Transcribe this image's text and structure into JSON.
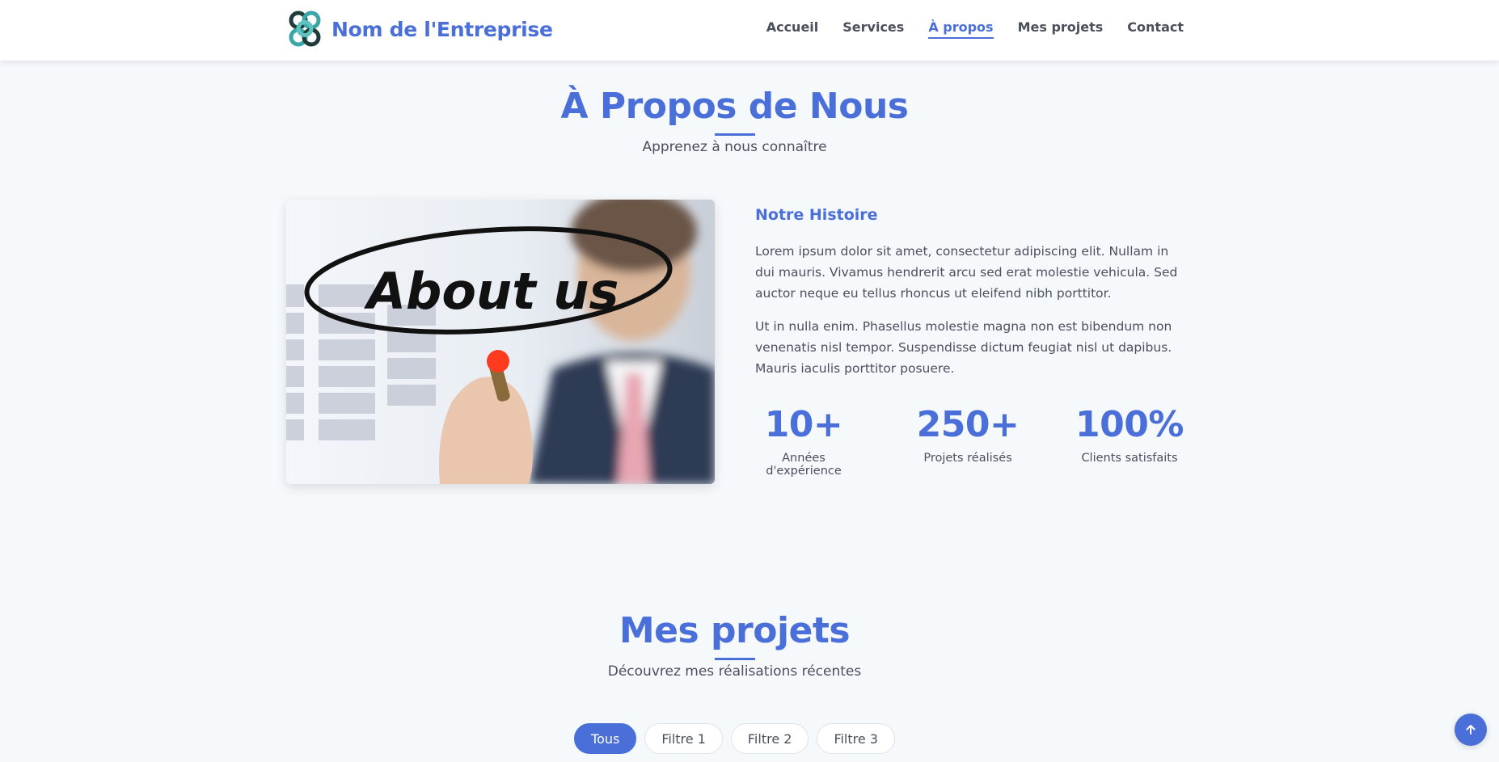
{
  "header": {
    "brand_name": "Nom de l'Entreprise",
    "logo_icon": "knot-logo-icon",
    "nav": [
      {
        "label": "Accueil",
        "active": false
      },
      {
        "label": "Services",
        "active": false
      },
      {
        "label": "À propos",
        "active": true
      },
      {
        "label": "Mes projets",
        "active": false
      },
      {
        "label": "Contact",
        "active": false
      }
    ]
  },
  "about": {
    "title": "À Propos de Nous",
    "subtitle": "Apprenez à nous connaître",
    "image_text": "About us",
    "heading": "Notre Histoire",
    "paragraphs": [
      "Lorem ipsum dolor sit amet, consectetur adipiscing elit. Nullam in dui mauris. Vivamus hendrerit arcu sed erat molestie vehicula. Sed auctor neque eu tellus rhoncus ut eleifend nibh porttitor.",
      "Ut in nulla enim. Phasellus molestie magna non est bibendum non venenatis nisl tempor. Suspendisse dictum feugiat nisl ut dapibus. Mauris iaculis porttitor posuere."
    ],
    "stats": [
      {
        "value": "10+",
        "label": "Années d'expérience"
      },
      {
        "value": "250+",
        "label": "Projets réalisés"
      },
      {
        "value": "100%",
        "label": "Clients satisfaits"
      }
    ]
  },
  "projects": {
    "title": "Mes projets",
    "subtitle": "Découvrez mes réalisations récentes",
    "filters": [
      {
        "label": "Tous",
        "active": true
      },
      {
        "label": "Filtre 1",
        "active": false
      },
      {
        "label": "Filtre 2",
        "active": false
      },
      {
        "label": "Filtre 3",
        "active": false
      }
    ]
  },
  "back_to_top_icon": "arrow-up-icon",
  "colors": {
    "accent": "#4a6fd8",
    "background": "#f6f9fc",
    "text": "#4a4f5c"
  }
}
